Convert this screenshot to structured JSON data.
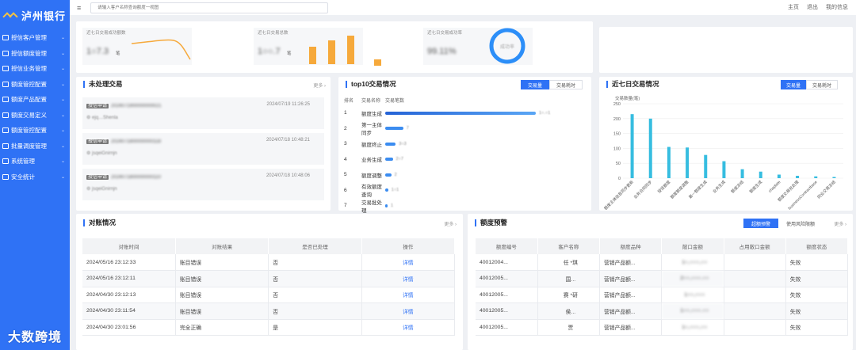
{
  "app": {
    "name": "泸州银行"
  },
  "sidebar": {
    "items": [
      {
        "label": "授信客户管理"
      },
      {
        "label": "授信额度管理"
      },
      {
        "label": "授信业务管理"
      },
      {
        "label": "额度管控配置"
      },
      {
        "label": "额度产品配置"
      },
      {
        "label": "额度交易定义"
      },
      {
        "label": "额度管控配置"
      },
      {
        "label": "批量调度管理"
      },
      {
        "label": "系统管理"
      },
      {
        "label": "安全统计"
      }
    ]
  },
  "topbar": {
    "search_placeholder": "请输入客户名称查询额度一视图",
    "links": [
      "主页",
      "退出",
      "我的信息"
    ]
  },
  "stats": [
    {
      "title": "近七日交易成功额数",
      "value": "1○7.3",
      "unit": "笔"
    },
    {
      "title": "近七日交易总数",
      "value": "1○○.7",
      "unit": "笔"
    },
    {
      "title": "近七日交易成功率",
      "value": "99.11%",
      "ring_label": "成功率"
    }
  ],
  "pending": {
    "title": "未处理交易",
    "more": "更多 ›",
    "items": [
      {
        "tag": "授信申请",
        "id": "2024071900000000021",
        "date": "2024/07/19 11:26:25",
        "name": "ejq…Shenla"
      },
      {
        "tag": "授信申请",
        "id": "2024071800000000118",
        "date": "2024/07/18 10:48:21",
        "name": "jsqeiGnirnjn"
      },
      {
        "tag": "授信申请",
        "id": "2024071800000000110",
        "date": "2024/07/18 10:48:06",
        "name": "jsqeiGnirnjn"
      }
    ]
  },
  "top10": {
    "title": "top10交易情况",
    "tabs": [
      "交易量",
      "交易耗时"
    ],
    "headers": [
      "排名",
      "交易名称",
      "交易笔数"
    ],
    "rows": [
      {
        "rank": "1",
        "name": "额度生成",
        "value": "1○.○1",
        "bar": 1.0
      },
      {
        "rank": "2",
        "name": "第一主体同步",
        "value": "7",
        "bar": 0.12
      },
      {
        "rank": "3",
        "name": "额度终止",
        "value": "3○3",
        "bar": 0.07
      },
      {
        "rank": "4",
        "name": "业务生成",
        "value": "2○7",
        "bar": 0.05
      },
      {
        "rank": "5",
        "name": "额度调整",
        "value": "2",
        "bar": 0.04
      },
      {
        "rank": "6",
        "name": "有效额度查询",
        "value": "1○1",
        "bar": 0.02
      },
      {
        "rank": "7",
        "name": "交易批处理",
        "value": "1",
        "bar": 0.01
      }
    ]
  },
  "weekly": {
    "title": "近七日交易情况",
    "tabs": [
      "交易量",
      "交易耗时"
    ],
    "chart_data": {
      "type": "bar",
      "ylabel": "交易数量(笔)",
      "ylim": [
        0,
        250
      ],
      "yticks": [
        0,
        50,
        100,
        150,
        200,
        250
      ],
      "categories": [
        "额度主体信息同步更新",
        "业务合同同步",
        "授信额度",
        "额度额度调整",
        "第一额度生成",
        "业务生成",
        "额度冻结",
        "额度生成",
        "chaplate",
        "额度交易批处理",
        "businessContractbase",
        "同业交易冻结"
      ],
      "values": [
        215,
        200,
        105,
        103,
        78,
        57,
        30,
        22,
        12,
        8,
        6,
        4
      ],
      "color": "#36bde0"
    }
  },
  "recon": {
    "title": "对账情况",
    "more": "更多 ›",
    "headers": [
      "对账时间",
      "对账结果",
      "是否已处理",
      "操作"
    ],
    "rows": [
      [
        "2024/05/16 23:12:33",
        "账目错误",
        "否",
        "详情"
      ],
      [
        "2024/05/16 23:12:11",
        "账目错误",
        "否",
        "详情"
      ],
      [
        "2024/04/30 23:12:13",
        "账目错误",
        "否",
        "详情"
      ],
      [
        "2024/04/30 23:11:54",
        "账目错误",
        "否",
        "详情"
      ],
      [
        "2024/04/30 23:01:56",
        "完全正确",
        "是",
        "详情"
      ]
    ]
  },
  "warning": {
    "title": "额度预警",
    "tabs": [
      "超额预警",
      "使用风险限额"
    ],
    "more": "更多 ›",
    "headers": [
      "额度编号",
      "客户名称",
      "额度品种",
      "敞口金额",
      "占用敞口金额",
      "额度状态"
    ],
    "rows": [
      [
        "40012004...",
        "任 *琪",
        "营销产品额...",
        "1○,○○○,○○",
        "",
        "失效"
      ],
      [
        "40012005...",
        "国...",
        "营销产品额...",
        "2○○,○○○.○○",
        "",
        "失效"
      ],
      [
        "40012005...",
        "赛 *研",
        "营销产品额...",
        "1○○,○○○",
        "",
        "失效"
      ],
      [
        "40012005...",
        "侯...",
        "营销产品额...",
        "1○○,○○○.○○",
        "",
        "失效"
      ],
      [
        "40012005...",
        "贾",
        "营销产品额...",
        "1○,○○○,○○",
        "",
        "失效"
      ]
    ]
  },
  "watermark": "大数跨境"
}
